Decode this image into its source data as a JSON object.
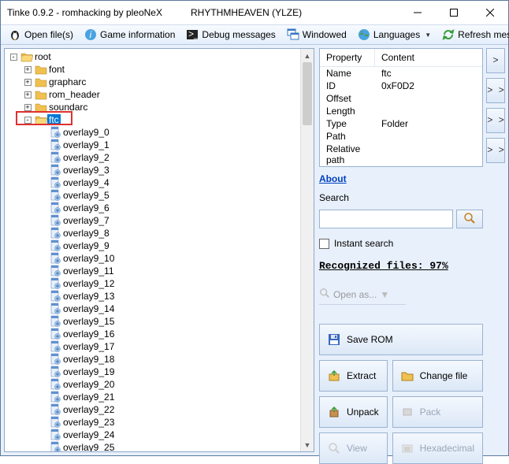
{
  "window": {
    "title": "Tinke 0.9.2 - romhacking by pleoNeX",
    "subtitle": "RHYTHMHEAVEN (YLZE)"
  },
  "toolbar": {
    "open": "Open file(s)",
    "gameinfo": "Game information",
    "debug": "Debug messages",
    "windowed": "Windowed",
    "languages": "Languages",
    "refresh": "Refresh messages"
  },
  "tree": {
    "root": "root",
    "folders": [
      "font",
      "grapharc",
      "rom_header",
      "soundarc"
    ],
    "selected": "ftc",
    "overlays_prefix": "overlay9_",
    "overlay_start": 0,
    "overlay_end": 25
  },
  "props": {
    "hdr_property": "Property",
    "hdr_content": "Content",
    "rows": [
      {
        "k": "Name",
        "v": "ftc"
      },
      {
        "k": "ID",
        "v": "0xF0D2"
      },
      {
        "k": "Offset",
        "v": ""
      },
      {
        "k": "Length",
        "v": ""
      },
      {
        "k": "Type",
        "v": "Folder"
      },
      {
        "k": "Path",
        "v": ""
      },
      {
        "k": "Relative path",
        "v": ""
      }
    ]
  },
  "right": {
    "about": "About",
    "search_label": "Search",
    "search_value": "",
    "search_placeholder": "",
    "instant": "Instant search",
    "recognized": "Recognized files: 97%",
    "openas": "Open as..."
  },
  "buttons": {
    "save": "Save ROM",
    "extract": "Extract",
    "change": "Change file",
    "unpack": "Unpack",
    "pack": "Pack",
    "view": "View",
    "hex": "Hexadecimal"
  },
  "arrows": [
    ">",
    "> >",
    "> >",
    "> >"
  ]
}
